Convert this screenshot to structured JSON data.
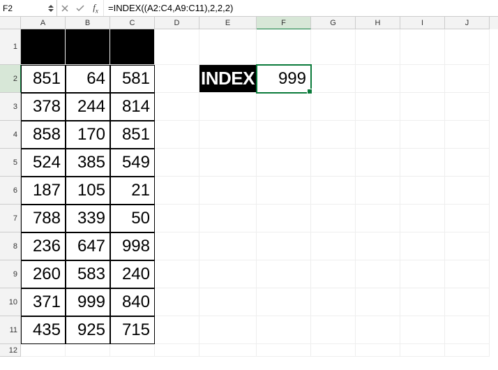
{
  "formula_bar": {
    "name_box": "F2",
    "formula": "=INDEX((A2:C4,A9:C11),2,2,2)"
  },
  "columns": [
    "A",
    "B",
    "C",
    "D",
    "E",
    "F",
    "G",
    "H",
    "I",
    "J"
  ],
  "col_widths": [
    "cA",
    "cB",
    "cC",
    "cD",
    "cE",
    "cF",
    "cG",
    "cH",
    "cI",
    "cJ"
  ],
  "selected_col": "F",
  "selected_row": "2",
  "grid": {
    "data_rows": [
      [
        "851",
        "64",
        "581"
      ],
      [
        "378",
        "244",
        "814"
      ],
      [
        "858",
        "170",
        "851"
      ],
      [
        "524",
        "385",
        "549"
      ],
      [
        "187",
        "105",
        "21"
      ],
      [
        "788",
        "339",
        "50"
      ],
      [
        "236",
        "647",
        "998"
      ],
      [
        "260",
        "583",
        "240"
      ],
      [
        "371",
        "999",
        "840"
      ],
      [
        "435",
        "925",
        "715"
      ]
    ],
    "label_e2": "INDEX",
    "value_f2": "999"
  }
}
